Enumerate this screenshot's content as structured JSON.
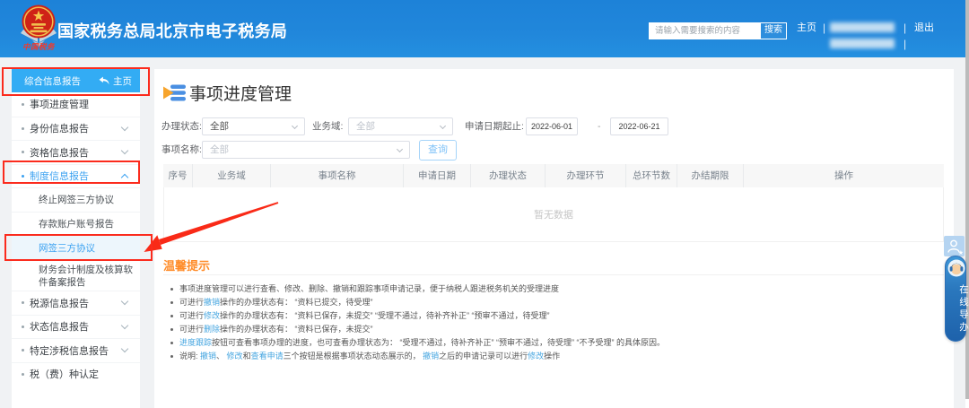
{
  "header": {
    "title": "国家税务总局北京市电子税务局",
    "logo_caption": "中国税务",
    "search_placeholder": "请输入需要搜索的内容",
    "search_button": "搜索",
    "home_link": "主页",
    "logout_link": "退出",
    "divider": "|"
  },
  "sidebar": {
    "active_section": "综合信息报告",
    "home_label": "主页",
    "items": [
      {
        "label": "事项进度管理"
      },
      {
        "label": "身份信息报告"
      },
      {
        "label": "资格信息报告"
      },
      {
        "label": "制度信息报告"
      },
      {
        "label": "终止网签三方协议"
      },
      {
        "label": "存款账户账号报告"
      },
      {
        "label": "网签三方协议"
      },
      {
        "label": "财务会计制度及核算软件备案报告"
      },
      {
        "label": "税源信息报告"
      },
      {
        "label": "状态信息报告"
      },
      {
        "label": "特定涉税信息报告"
      },
      {
        "label": "税（费）种认定"
      }
    ]
  },
  "main": {
    "page_title": "事项进度管理",
    "filters": {
      "status_label": "办理状态:",
      "status_value": "全部",
      "domain_label": "业务域:",
      "domain_value": "全部",
      "date_label": "申请日期起止:",
      "date_from": "2022-06-01",
      "date_sep": "-",
      "date_to": "2022-06-21",
      "name_label": "事项名称:",
      "name_value": "全部",
      "query_button": "查询"
    },
    "table": {
      "columns": [
        "序号",
        "业务域",
        "事项名称",
        "申请日期",
        "办理状态",
        "办理环节",
        "总环节数",
        "办结期限",
        "操作"
      ],
      "empty_text": "暂无数据"
    },
    "tips": {
      "title": "温馨提示",
      "items": [
        [
          {
            "t": "事项进度管理可以进行查看、修改、删除、撤销和跟踪事项申请记录，便于纳税人跟进税务机关的受理进度"
          }
        ],
        [
          {
            "t": "可进行"
          },
          {
            "t": "撤销",
            "l": 1
          },
          {
            "t": "操作的办理状态有： “资料已提交，待受理”"
          }
        ],
        [
          {
            "t": "可进行"
          },
          {
            "t": "修改",
            "l": 1
          },
          {
            "t": "操作的办理状态有： “资料已保存，未提交” “受理不通过，待补齐补正” “预审不通过，待受理”"
          }
        ],
        [
          {
            "t": "可进行"
          },
          {
            "t": "删除",
            "l": 1
          },
          {
            "t": "操作的办理状态有： “资料已保存，未提交”"
          }
        ],
        [
          {
            "t": "进度跟踪",
            "l": 1
          },
          {
            "t": "按钮可查看事项办理的进度，也可查看办理状态为： “受理不通过，待补齐补正” “预审不通过，待受理” “不予受理” 的具体原因。"
          }
        ],
        [
          {
            "t": "说明: "
          },
          {
            "t": "撤销",
            "l": 1
          },
          {
            "t": "、 "
          },
          {
            "t": "修改",
            "l": 1
          },
          {
            "t": "和"
          },
          {
            "t": "查看申请",
            "l": 1
          },
          {
            "t": "三个按钮是根据事项状态动态展示的， "
          },
          {
            "t": "撤销",
            "l": 1
          },
          {
            "t": "之后的申请记录可以进行"
          },
          {
            "t": "修改",
            "l": 1
          },
          {
            "t": "操作"
          }
        ]
      ]
    }
  },
  "floating": {
    "online_guide": "在线导办"
  }
}
